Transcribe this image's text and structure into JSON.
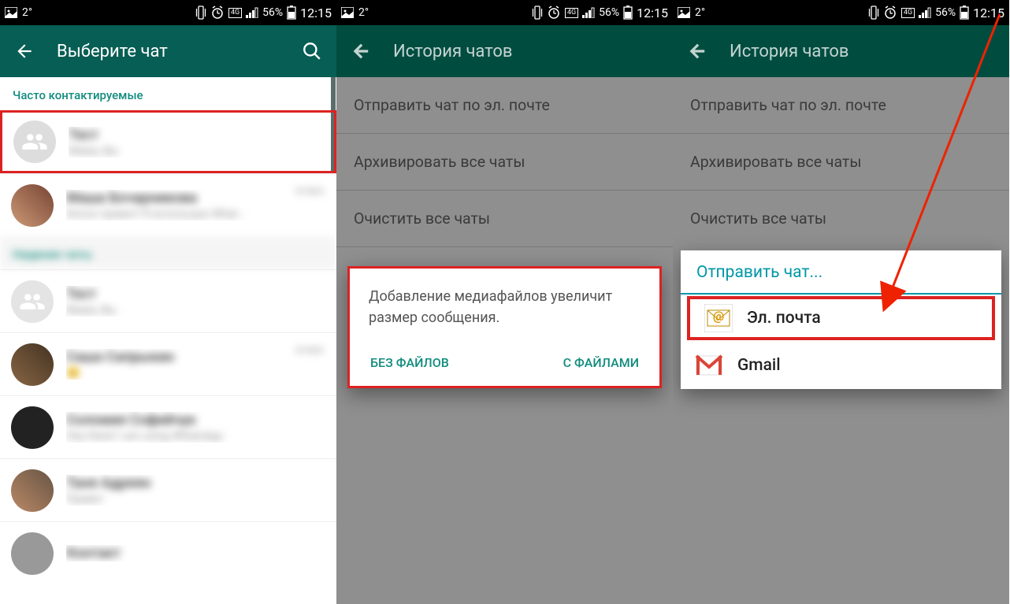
{
  "status": {
    "temp": "2°",
    "battery_pct": "56%",
    "time": "12:15",
    "network_label": "4G"
  },
  "screen1": {
    "title": "Выберите чат",
    "section_frequent": "Часто контактируемые",
    "section_recent": "Недвние чаты",
    "contacts": [
      {
        "name": "Тест",
        "sub": "Мама, Вы",
        "time": ""
      },
      {
        "name": "Маша Бочарникова",
        "sub": "Хелло привет! Я использую What...",
        "time": "вчера"
      }
    ],
    "recent_contacts": [
      {
        "name": "Тест",
        "sub": "Мама, Вы",
        "time": ""
      },
      {
        "name": "Саша Сапрыкин",
        "sub": "😊",
        "time": "вчера"
      },
      {
        "name": "Соломия Софийчук",
        "sub": "Hey there! I am using WhatsApp",
        "time": ""
      },
      {
        "name": "Таня Адреян",
        "sub": "Привет",
        "time": ""
      },
      {
        "name": "Контакт",
        "sub": "",
        "time": ""
      }
    ]
  },
  "screen2": {
    "title": "История чатов",
    "items": [
      "Отправить чат по эл. почте",
      "Архивировать все чаты",
      "Очистить все чаты"
    ],
    "dialog_text": "Добавление медиафайлов увеличит размер сообщения.",
    "btn_without": "БЕЗ ФАЙЛОВ",
    "btn_with": "С ФАЙЛАМИ"
  },
  "screen3": {
    "title": "История чатов",
    "items": [
      "Отправить чат по эл. почте",
      "Архивировать все чаты",
      "Очистить все чаты"
    ],
    "sheet_title": "Отправить чат...",
    "sheet_items": [
      "Эл. почта",
      "Gmail"
    ]
  }
}
